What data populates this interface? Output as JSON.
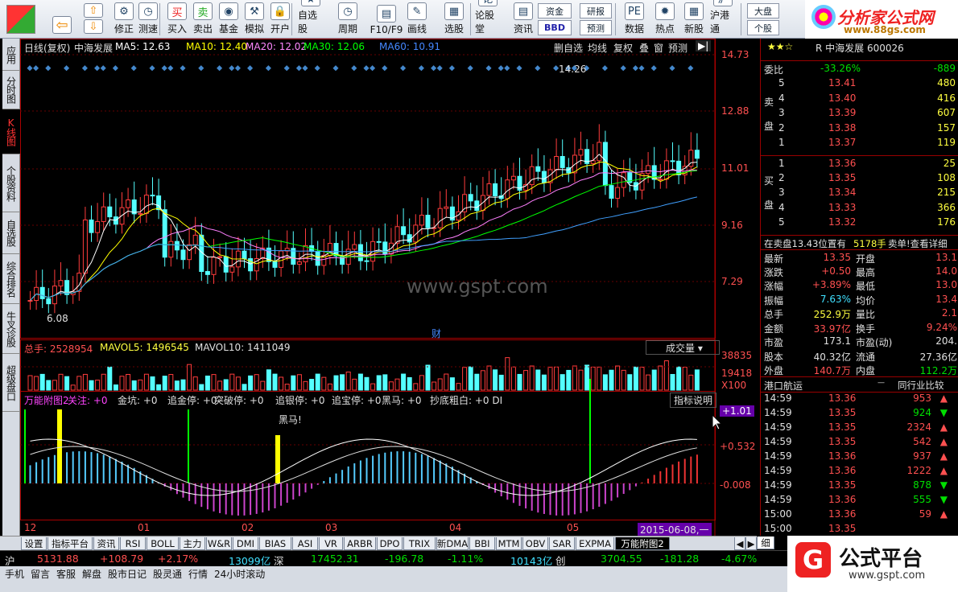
{
  "toolbar": {
    "buttons": [
      {
        "name": "back-button",
        "label": "",
        "icon": "⇦"
      },
      {
        "name": "revise-button",
        "label": "修正",
        "icon": "⚙"
      },
      {
        "name": "backtest-button",
        "label": "测速",
        "icon": "◷"
      },
      {
        "name": "buy-button",
        "label": "买入",
        "icon": "买"
      },
      {
        "name": "sell-button",
        "label": "卖出",
        "icon": "卖"
      },
      {
        "name": "fund-button",
        "label": "基金",
        "icon": "◉"
      },
      {
        "name": "simulate-button",
        "label": "模拟",
        "icon": "⚒"
      },
      {
        "name": "open-account-button",
        "label": "开户",
        "icon": "🔒"
      },
      {
        "name": "watchlist-button",
        "label": "自选股",
        "icon": "★"
      },
      {
        "name": "period-button",
        "label": "周期",
        "icon": "◷"
      },
      {
        "name": "f10-button",
        "label": "F10/F9",
        "icon": "▤"
      },
      {
        "name": "draw-button",
        "label": "画线",
        "icon": "✎"
      },
      {
        "name": "stock-select-button",
        "label": "选股",
        "icon": "▦"
      },
      {
        "name": "forum-button",
        "label": "论股堂",
        "icon": "论"
      },
      {
        "name": "info-button",
        "label": "资讯",
        "icon": "▤"
      },
      {
        "name": "data-button",
        "label": "数据",
        "icon": "PE"
      },
      {
        "name": "hot-button",
        "label": "热点",
        "icon": "✹"
      },
      {
        "name": "new-stock-button",
        "label": "新股",
        "icon": "▦"
      },
      {
        "name": "hk-connect-button",
        "label": "沪港通",
        "icon": "沪"
      }
    ],
    "fund_flow": "资金",
    "bbd": "BBD",
    "research": "研报",
    "forecast": "预测",
    "market": "大盘",
    "individual": "个股"
  },
  "logo": {
    "title": "分析家公式网",
    "url": "www.88gs.com"
  },
  "sidetabs": [
    {
      "label": "应用",
      "active": false
    },
    {
      "label": "分时图",
      "active": false
    },
    {
      "label": "K线图",
      "active": true
    },
    {
      "label": "个股资料",
      "active": false
    },
    {
      "label": "自选股",
      "active": false
    },
    {
      "label": "综合排名",
      "active": false
    },
    {
      "label": "牛叉诊股",
      "active": false
    },
    {
      "label": "超级盘口",
      "active": false
    }
  ],
  "kline": {
    "header_period": "日线(复权)",
    "stock_name": "中海发展",
    "ma5": "MA5: 12.63",
    "ma10": "MA10: 12.40",
    "ma20": "MA20: 12.02",
    "ma30": "MA30: 12.06",
    "ma60": "MA60: 10.91",
    "btn_delete_watch": "删自选",
    "btn_ma": "均线",
    "btn_restore": "复权",
    "btn_overlay": "叠",
    "btn_window": "窗",
    "btn_forecast": "预测",
    "price_ticks": [
      "14.73",
      "12.88",
      "11.01",
      "9.16",
      "7.29"
    ],
    "high_mark": "14.26",
    "low_mark": "6.08",
    "watermark": "www.gspt.com",
    "finance_mark": "财"
  },
  "volume": {
    "total": "总手: 2528954",
    "mavol5": "MAVOL5: 1496545",
    "mavol10": "MAVOL10: 1411049",
    "selector": "成交量",
    "ticks": [
      "38835",
      "19418",
      "X100"
    ]
  },
  "indicator": {
    "name": "万能附图2",
    "items": [
      "关注: +0",
      "金坑: +0",
      "追金停: +0",
      "突破停: +0",
      "追银停: +0",
      "追宝停: +0",
      "黑马: +0",
      "抄底粗白: +0 DI"
    ],
    "help": "指标说明",
    "ticks": [
      "+1.01",
      "+0.532",
      "-0.008"
    ],
    "dark_horse_label": "黑马!"
  },
  "xaxis": {
    "months": [
      "12",
      "01",
      "02",
      "03",
      "04",
      "05"
    ],
    "cursor_date": "2015-06-08,一"
  },
  "quote": {
    "stars": "★★☆",
    "code_line": "R 中海发展 600026",
    "weibi_label": "委比",
    "weibi": "-33.26%",
    "weicha": "-889",
    "sell_label": [
      "卖",
      "盘"
    ],
    "buy_label": [
      "买",
      "盘"
    ],
    "sell": [
      {
        "lv": "5",
        "price": "13.41",
        "vol": "480"
      },
      {
        "lv": "4",
        "price": "13.40",
        "vol": "416"
      },
      {
        "lv": "3",
        "price": "13.39",
        "vol": "607"
      },
      {
        "lv": "2",
        "price": "13.38",
        "vol": "157"
      },
      {
        "lv": "1",
        "price": "13.37",
        "vol": "119"
      }
    ],
    "buy": [
      {
        "lv": "1",
        "price": "13.36",
        "vol": "25"
      },
      {
        "lv": "2",
        "price": "13.35",
        "vol": "108"
      },
      {
        "lv": "3",
        "price": "13.34",
        "vol": "215"
      },
      {
        "lv": "4",
        "price": "13.33",
        "vol": "366"
      },
      {
        "lv": "5",
        "price": "13.32",
        "vol": "176"
      }
    ],
    "pos_note": "在卖盘13.43位置有",
    "pos_vol": "5178手",
    "pos_link": "卖单!查看详细",
    "stats": [
      {
        "l": "最新",
        "v": "13.35",
        "l2": "开盘",
        "v2": "13.1"
      },
      {
        "l": "涨跌",
        "v": "+0.50",
        "l2": "最高",
        "v2": "14.0"
      },
      {
        "l": "涨幅",
        "v": "+3.89%",
        "l2": "最低",
        "v2": "13.0"
      },
      {
        "l": "振幅",
        "v": "7.63%",
        "l2": "均价",
        "v2": "13.4"
      },
      {
        "l": "总手",
        "v": "252.9万",
        "l2": "量比",
        "v2": "2.1"
      },
      {
        "l": "金额",
        "v": "33.97亿",
        "l2": "换手",
        "v2": "9.24%"
      },
      {
        "l": "市盈",
        "v": "173.1",
        "l2": "市盈(动)",
        "v2": "204."
      },
      {
        "l": "股本",
        "v": "40.32亿",
        "l2": "流通",
        "v2": "27.36亿"
      },
      {
        "l": "外盘",
        "v": "140.7万",
        "l2": "内盘",
        "v2": "112.2万"
      }
    ],
    "sector": "港口航运",
    "sector_cmp": "同行业比较",
    "ticks": [
      {
        "t": "14:59",
        "p": "13.36",
        "v": "953",
        "d": "up"
      },
      {
        "t": "14:59",
        "p": "13.35",
        "v": "924",
        "d": "down"
      },
      {
        "t": "14:59",
        "p": "13.35",
        "v": "2324",
        "d": "up"
      },
      {
        "t": "14:59",
        "p": "13.35",
        "v": "542",
        "d": "up"
      },
      {
        "t": "14:59",
        "p": "13.36",
        "v": "937",
        "d": "up"
      },
      {
        "t": "14:59",
        "p": "13.36",
        "v": "1222",
        "d": "up"
      },
      {
        "t": "14:59",
        "p": "13.35",
        "v": "878",
        "d": "down"
      },
      {
        "t": "14:59",
        "p": "13.36",
        "v": "555",
        "d": "down"
      },
      {
        "t": "15:00",
        "p": "13.36",
        "v": "59",
        "d": "up"
      },
      {
        "t": "15:00",
        "p": "13.35",
        "v": "",
        "d": ""
      }
    ]
  },
  "bottom_tabs": [
    "设置",
    "指标平台",
    "资讯",
    "RSI",
    "BOLL",
    "主力",
    "W&R",
    "DMI",
    "BIAS",
    "ASI",
    "VR",
    "ARBR",
    "DPO",
    "TRIX",
    "新DMA",
    "BBI",
    "MTM",
    "OBV",
    "SAR",
    "EXPMA",
    "万能附图2"
  ],
  "right_tab_label": "细",
  "status": {
    "sh": "沪",
    "sh_idx": "5131.88",
    "sh_chg": "+108.79",
    "sh_pct": "+2.17%",
    "sh_amt": "13099亿",
    "sz": "深",
    "sz_idx": "17452.31",
    "sz_chg": "-196.78",
    "sz_pct": "-1.11%",
    "sz_amt": "10143亿",
    "cy": "创",
    "cy_idx": "3704.55",
    "cy_chg": "-181.28",
    "cy_pct": "-4.67%"
  },
  "taskbar": [
    "手机",
    "留言",
    "客服",
    "解盘",
    "股市日记",
    "股灵通",
    "行情",
    "24小时滚动"
  ],
  "brand": {
    "name": "公式平台",
    "url": "www.gspt.com"
  },
  "colors": {
    "up": "#ff3c3c",
    "down": "#54ffff",
    "ma5": "#ffffff",
    "ma10": "#ffff00",
    "ma20": "#ff80ff",
    "ma30": "#00ff00",
    "ma60": "#40a0ff"
  }
}
